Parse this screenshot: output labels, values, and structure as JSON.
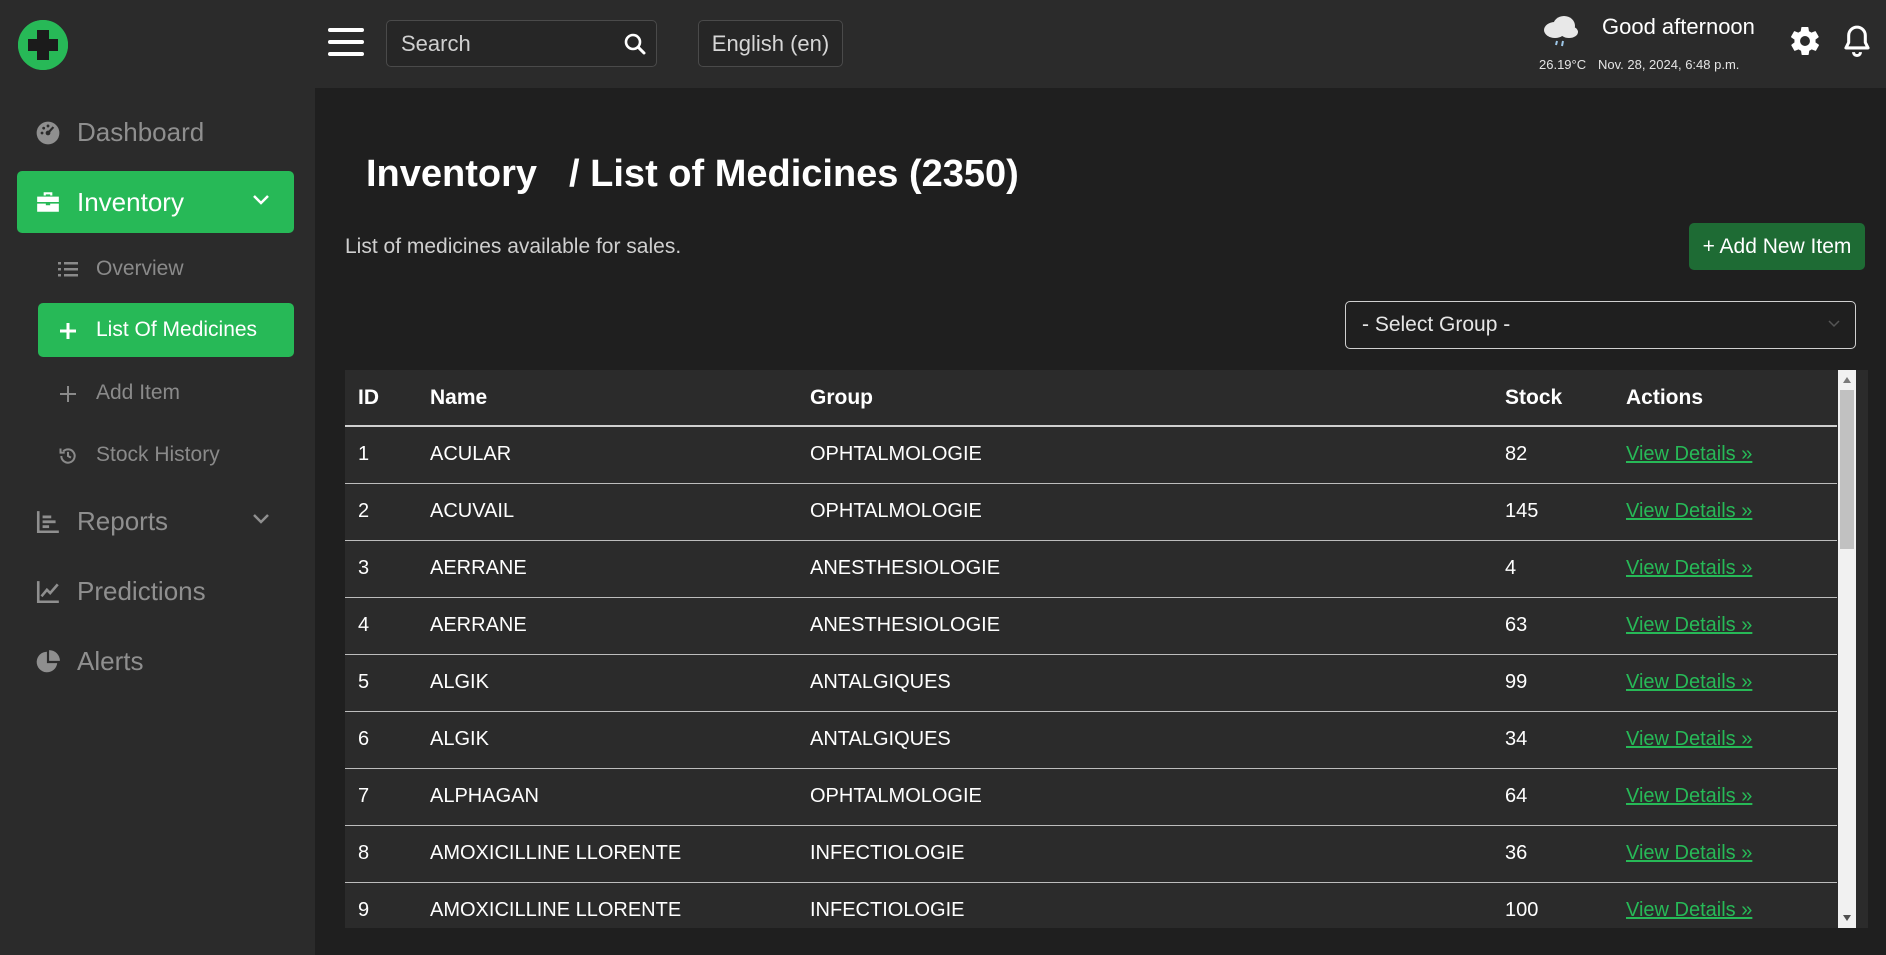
{
  "header": {
    "search_placeholder": "Search",
    "language": "English (en)",
    "greeting": "Good afternoon",
    "temperature": "26.19°C",
    "datetime": "Nov. 28, 2024, 6:48 p.m.",
    "icons": {
      "logo": "pharmacy-cross-logo",
      "menu": "hamburger-icon",
      "search": "search-icon",
      "weather": "cloud-rain-icon",
      "settings": "gear-icon",
      "notifications": "bell-icon"
    }
  },
  "sidebar": {
    "items": [
      {
        "label": "Dashboard",
        "icon": "gauge-icon",
        "active": false
      },
      {
        "label": "Inventory",
        "icon": "briefcase-icon",
        "active": true,
        "expanded": true
      },
      {
        "label": "Reports",
        "icon": "bar-chart-icon",
        "active": false
      },
      {
        "label": "Predictions",
        "icon": "line-chart-icon",
        "active": false
      },
      {
        "label": "Alerts",
        "icon": "pie-chart-icon",
        "active": false
      }
    ],
    "inventory_sub": [
      {
        "label": "Overview",
        "icon": "list-icon"
      },
      {
        "label": "List Of Medicines",
        "icon": "plus-icon",
        "active": true
      },
      {
        "label": "Add Item",
        "icon": "plus-icon"
      },
      {
        "label": "Stock History",
        "icon": "history-icon"
      }
    ]
  },
  "page": {
    "breadcrumb_root": "Inventory",
    "title": "/ List of Medicines (2350)",
    "subtitle": "List of medicines available for sales.",
    "add_button": "+ Add New Item",
    "group_select": "- Select Group -"
  },
  "table": {
    "columns": [
      "ID",
      "Name",
      "Group",
      "Stock",
      "Actions"
    ],
    "rows": [
      {
        "id": "1",
        "name": "ACULAR",
        "group": "OPHTALMOLOGIE",
        "stock": "82",
        "action": "View Details »"
      },
      {
        "id": "2",
        "name": "ACUVAIL",
        "group": "OPHTALMOLOGIE",
        "stock": "145",
        "action": "View Details »"
      },
      {
        "id": "3",
        "name": "AERRANE",
        "group": "ANESTHESIOLOGIE",
        "stock": "4",
        "action": "View Details »"
      },
      {
        "id": "4",
        "name": "AERRANE",
        "group": "ANESTHESIOLOGIE",
        "stock": "63",
        "action": "View Details »"
      },
      {
        "id": "5",
        "name": "ALGIK",
        "group": "ANTALGIQUES",
        "stock": "99",
        "action": "View Details »"
      },
      {
        "id": "6",
        "name": "ALGIK",
        "group": "ANTALGIQUES",
        "stock": "34",
        "action": "View Details »"
      },
      {
        "id": "7",
        "name": "ALPHAGAN",
        "group": "OPHTALMOLOGIE",
        "stock": "64",
        "action": "View Details »"
      },
      {
        "id": "8",
        "name": "AMOXICILLINE LLORENTE",
        "group": "INFECTIOLOGIE",
        "stock": "36",
        "action": "View Details »"
      },
      {
        "id": "9",
        "name": "AMOXICILLINE LLORENTE",
        "group": "INFECTIOLOGIE",
        "stock": "100",
        "action": "View Details »"
      }
    ]
  },
  "colors": {
    "accent": "#27b957",
    "accent_dark": "#1e6b34",
    "sidebar_bg": "#2b2b2b",
    "main_bg": "#1f1f1f",
    "muted_text": "#8f8f8f"
  }
}
